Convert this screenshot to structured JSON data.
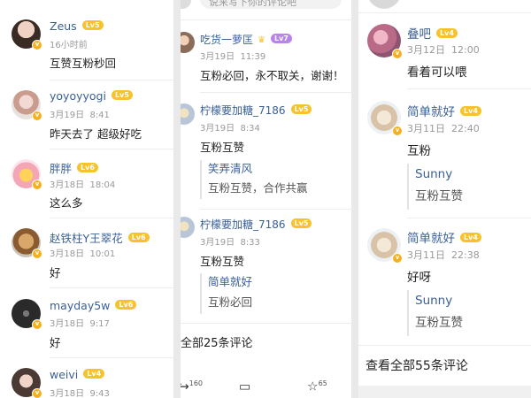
{
  "left_panel": {
    "comments": [
      {
        "user": "Zeus",
        "level": "Lv5",
        "time": "16小时前",
        "text": "互赞互粉秒回"
      },
      {
        "user": "yoyoyyogi",
        "level": "Lv5",
        "time": "3月19日",
        "time2": "8:41",
        "text": "昨天去了 超级好吃"
      },
      {
        "user": "胖胖",
        "level": "Lv6",
        "time": "3月18日",
        "time2": "18:04",
        "text": "这么多"
      },
      {
        "user": "赵铁柱Y王翠花",
        "level": "Lv6",
        "time": "3月18日",
        "time2": "10:01",
        "text": "好"
      },
      {
        "user": "mayday5w",
        "level": "Lv6",
        "time": "3月18日",
        "time2": "9:17",
        "text": "好"
      },
      {
        "user": "weivi",
        "level": "Lv4",
        "time": "3月18日",
        "time2": "9:43",
        "text": ""
      }
    ]
  },
  "middle_panel": {
    "input_placeholder": "说来写下你的评论吧",
    "comments": [
      {
        "user": "吃货一萝匡",
        "level": "Lv7",
        "time": "3月19日",
        "time2": "11:39",
        "text": "互粉必回，永不取关，谢谢！"
      },
      {
        "user": "柠檬要加糖_7186",
        "level": "Lv5",
        "time": "3月19日",
        "time2": "8:34",
        "text": "互粉互赞",
        "reply": {
          "user": "笑弄清风",
          "text": "互粉互赞，合作共赢"
        }
      },
      {
        "user": "柠檬要加糖_7186",
        "level": "Lv5",
        "time": "3月19日",
        "time2": "8:33",
        "text": "互粉互赞",
        "reply": {
          "user": "简单就好",
          "text": "互粉必回"
        }
      }
    ],
    "view_all": "全部25条评论",
    "bottom_bar": {
      "share_count": "160",
      "comment_count": "",
      "like_count": "65"
    }
  },
  "right_panel": {
    "comments": [
      {
        "user": "叠吧",
        "level": "Lv4",
        "time": "3月12日",
        "time2": "12:00",
        "text": "看着可以喂"
      },
      {
        "user": "简单就好",
        "level": "Lv4",
        "time": "3月11日",
        "time2": "22:40",
        "text": "互粉",
        "reply": {
          "user": "Sunny",
          "text": "互粉互赞"
        }
      },
      {
        "user": "简单就好",
        "level": "Lv4",
        "time": "3月11日",
        "time2": "22:38",
        "text": "好呀",
        "reply": {
          "user": "Sunny",
          "text": "互粉互赞"
        }
      }
    ],
    "view_all": "查看全部55条评论"
  },
  "colors": {
    "username": "#3a5f95",
    "level_badge": "#f7c22b",
    "level_badge_vip": "#b784e8",
    "timestamp": "#999999"
  }
}
